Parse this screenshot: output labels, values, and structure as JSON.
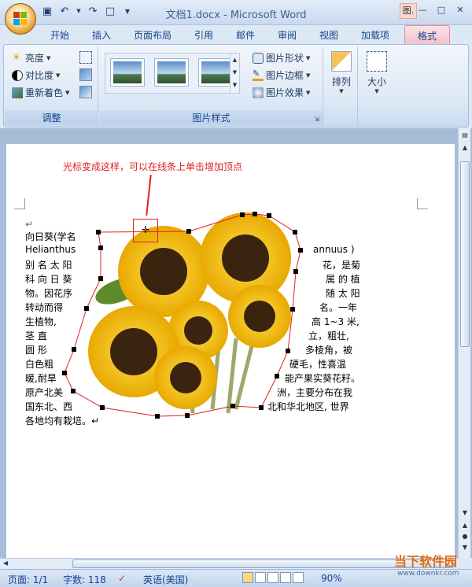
{
  "window": {
    "title": "文档1.docx - Microsoft Word",
    "ctx_hint": "图."
  },
  "tabs": [
    "开始",
    "插入",
    "页面布局",
    "引用",
    "邮件",
    "审阅",
    "视图",
    "加载项"
  ],
  "active_tab": "格式",
  "ribbon": {
    "adjust": {
      "label": "调整",
      "brightness": "亮度",
      "contrast": "对比度",
      "recolor": "重新着色"
    },
    "picture_styles": {
      "label": "图片样式",
      "shape": "图片形状",
      "border": "图片边框",
      "effects": "图片效果"
    },
    "arrange": "排列",
    "size": "大小"
  },
  "annotation": "光标变成这样，可以在线条上单击增加顶点",
  "document": {
    "left_lines": [
      "向日葵(学名",
      "Helianthus",
      "别 名 太 阳",
      "科 向 日 葵",
      "物。因花序",
      "转动而得",
      "生植物,",
      "茎    直",
      "圆    形",
      "白色粗",
      "暖,耐旱",
      "原产北美",
      "国东北、西",
      "各地均有栽培。↵"
    ],
    "right_lines": [
      "annuus )",
      "花，是菊",
      "属 的 植",
      "随 太 阳",
      "名。一年",
      "高 1~3 米,",
      "立，粗壮,",
      "多棱角，被",
      "硬毛，性喜温",
      "能产果实葵花籽。",
      "洲，主要分布在我",
      "北和华北地区, 世界"
    ],
    "para_mark": "↵"
  },
  "status": {
    "page": "页面: 1/1",
    "words": "字数: 118",
    "language": "英语(美国)",
    "zoom": "90%"
  },
  "watermark": {
    "brand": "当下软件园",
    "url": "www.downkr.com"
  }
}
